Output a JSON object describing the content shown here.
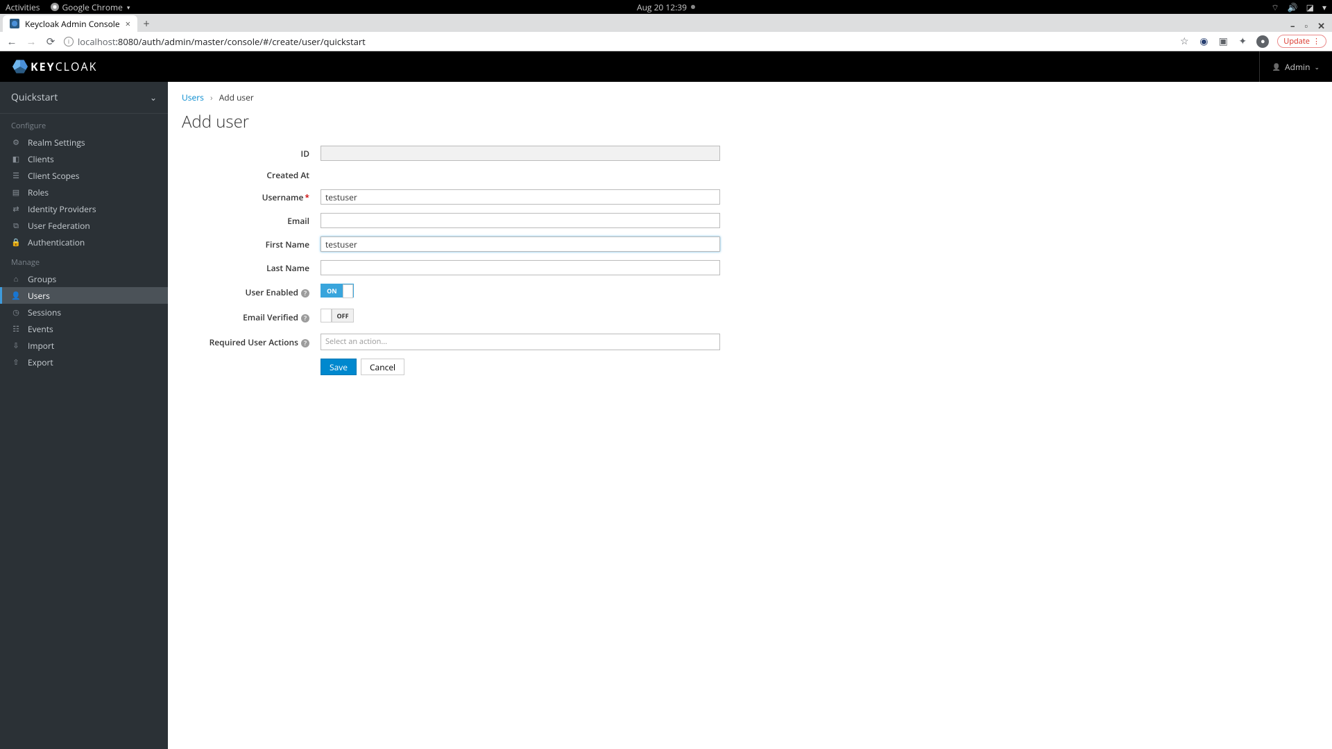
{
  "gnome": {
    "activities": "Activities",
    "app": "Google Chrome",
    "clock": "Aug 20  12:39"
  },
  "chrome": {
    "tab_title": "Keycloak Admin Console",
    "url_host": "localhost",
    "url_path": ":8080/auth/admin/master/console/#/create/user/quickstart",
    "update_label": "Update"
  },
  "header": {
    "brand_prefix": "KEY",
    "brand_suffix": "CLOAK",
    "user": "Admin"
  },
  "sidebar": {
    "realm": "Quickstart",
    "section_configure": "Configure",
    "section_manage": "Manage",
    "configure": [
      {
        "label": "Realm Settings",
        "icon": "⚙"
      },
      {
        "label": "Clients",
        "icon": "◧"
      },
      {
        "label": "Client Scopes",
        "icon": "☰"
      },
      {
        "label": "Roles",
        "icon": "▤"
      },
      {
        "label": "Identity Providers",
        "icon": "⇄"
      },
      {
        "label": "User Federation",
        "icon": "⧉"
      },
      {
        "label": "Authentication",
        "icon": "🔒"
      }
    ],
    "manage": [
      {
        "label": "Groups",
        "icon": "⌂",
        "active": false
      },
      {
        "label": "Users",
        "icon": "👤",
        "active": true
      },
      {
        "label": "Sessions",
        "icon": "◷",
        "active": false
      },
      {
        "label": "Events",
        "icon": "☷",
        "active": false
      },
      {
        "label": "Import",
        "icon": "⇩",
        "active": false
      },
      {
        "label": "Export",
        "icon": "⇧",
        "active": false
      }
    ]
  },
  "breadcrumb": {
    "parent": "Users",
    "current": "Add user"
  },
  "page": {
    "title": "Add user"
  },
  "form": {
    "id": {
      "label": "ID",
      "value": ""
    },
    "created_at": {
      "label": "Created At"
    },
    "username": {
      "label": "Username",
      "value": "testuser",
      "required": true
    },
    "email": {
      "label": "Email",
      "value": ""
    },
    "first_name": {
      "label": "First Name",
      "value": "testuser"
    },
    "last_name": {
      "label": "Last Name",
      "value": ""
    },
    "user_enabled": {
      "label": "User Enabled",
      "on_text": "ON",
      "off_text": "OFF",
      "value": true
    },
    "email_verified": {
      "label": "Email Verified",
      "on_text": "ON",
      "off_text": "OFF",
      "value": false
    },
    "required_actions": {
      "label": "Required User Actions",
      "placeholder": "Select an action..."
    },
    "save": "Save",
    "cancel": "Cancel"
  }
}
